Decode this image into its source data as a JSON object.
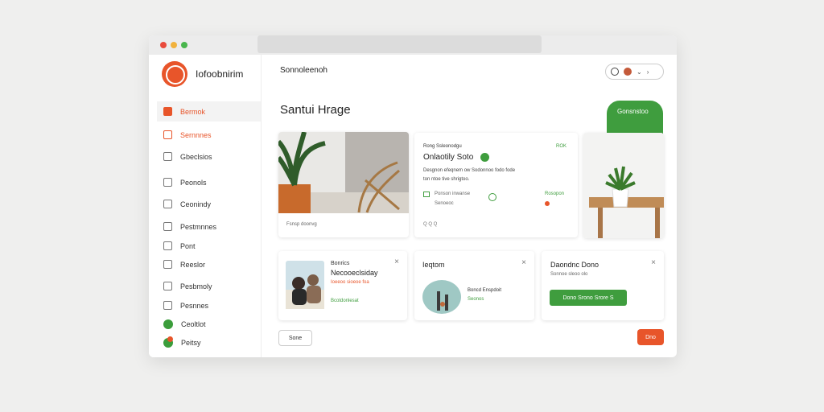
{
  "window": {
    "title": ""
  },
  "sidebar": {
    "brand": "Iofoobnirim",
    "items": [
      {
        "label": "Bermok",
        "icon": "bag-icon"
      },
      {
        "label": "Sernnnes",
        "icon": "calendar-icon"
      },
      {
        "label": "Gbeclsios",
        "icon": "bookmark-icon"
      },
      {
        "label": "Peonols",
        "icon": "edit-icon"
      },
      {
        "label": "Ceonindy",
        "icon": "lock-icon"
      },
      {
        "label": "Pestmnnes",
        "icon": "doc-icon"
      },
      {
        "label": "Pont",
        "icon": "check-icon"
      },
      {
        "label": "Reeslor",
        "icon": "grid-icon"
      },
      {
        "label": "Pesbmoly",
        "icon": "image-icon"
      },
      {
        "label": "Pesnnes",
        "icon": "folder-icon"
      },
      {
        "label": "Ceoltlot",
        "icon": "leaf-icon"
      },
      {
        "label": "Peitsy",
        "icon": "badge-icon"
      }
    ]
  },
  "header": {
    "section": "Sonnoleenoh",
    "title": "Santui Hrage",
    "badge": "Gonsnstoo"
  },
  "featured": {
    "caption": "Fsnsp doonvg",
    "tag": "Rong Ssleonodgu",
    "price": "ROK",
    "name": "Onlaotily Soto",
    "desc1": "Desgnon efeqnem ow Sodonnoo fodo fode",
    "desc2": "ton ntoe tive shrigtoo.",
    "meta1": "Ponson inwanse",
    "meta2": "Senoeoc",
    "meta3": "Rosopon",
    "stats": "Q  Q  Q"
  },
  "cards": [
    {
      "name": "Bonrics",
      "title": "Necooeclsiday",
      "sub": "Ioeeoo sioeoe foa",
      "link": "Bcotdonlesat"
    },
    {
      "name": "Ieqtom",
      "meta1": "Boncd Enspdoit",
      "meta2": "Seonos"
    },
    {
      "name": "Daondnc Dono",
      "sub": "Sonnoe sleoo olo",
      "button": "Dono Srono Srore S"
    }
  ],
  "footer": {
    "left_button": "Sone",
    "right_button": "Dno"
  }
}
